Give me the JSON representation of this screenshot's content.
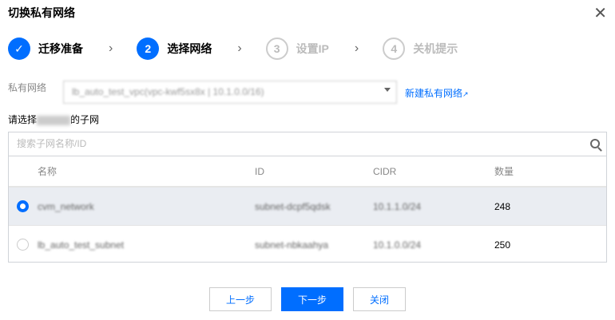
{
  "dialog": {
    "title": "切换私有网络"
  },
  "steps": [
    {
      "num": "✓",
      "label": "迁移准备"
    },
    {
      "num": "2",
      "label": "选择网络"
    },
    {
      "num": "3",
      "label": "设置IP"
    },
    {
      "num": "4",
      "label": "关机提示"
    }
  ],
  "vpc": {
    "label": "私有网络",
    "value": "lb_auto_test_vpc(vpc-kwf5sx8x | 10.1.0.0/16)",
    "new_link": "新建私有网络"
  },
  "subnet": {
    "prompt_prefix": "请选择",
    "prompt_suffix": "的子网",
    "search_placeholder": "搜索子网名称/ID",
    "columns": [
      "名称",
      "ID",
      "CIDR",
      "数量"
    ],
    "rows": [
      {
        "name": "cvm_network",
        "id": "subnet-dcpf5qdsk",
        "cidr": "10.1.1.0/24",
        "count": "248",
        "selected": true
      },
      {
        "name": "lb_auto_test_subnet",
        "id": "subnet-nbkaahya",
        "cidr": "10.1.0.0/24",
        "count": "250",
        "selected": false
      }
    ]
  },
  "buttons": {
    "prev": "上一步",
    "next": "下一步",
    "close": "关闭"
  }
}
